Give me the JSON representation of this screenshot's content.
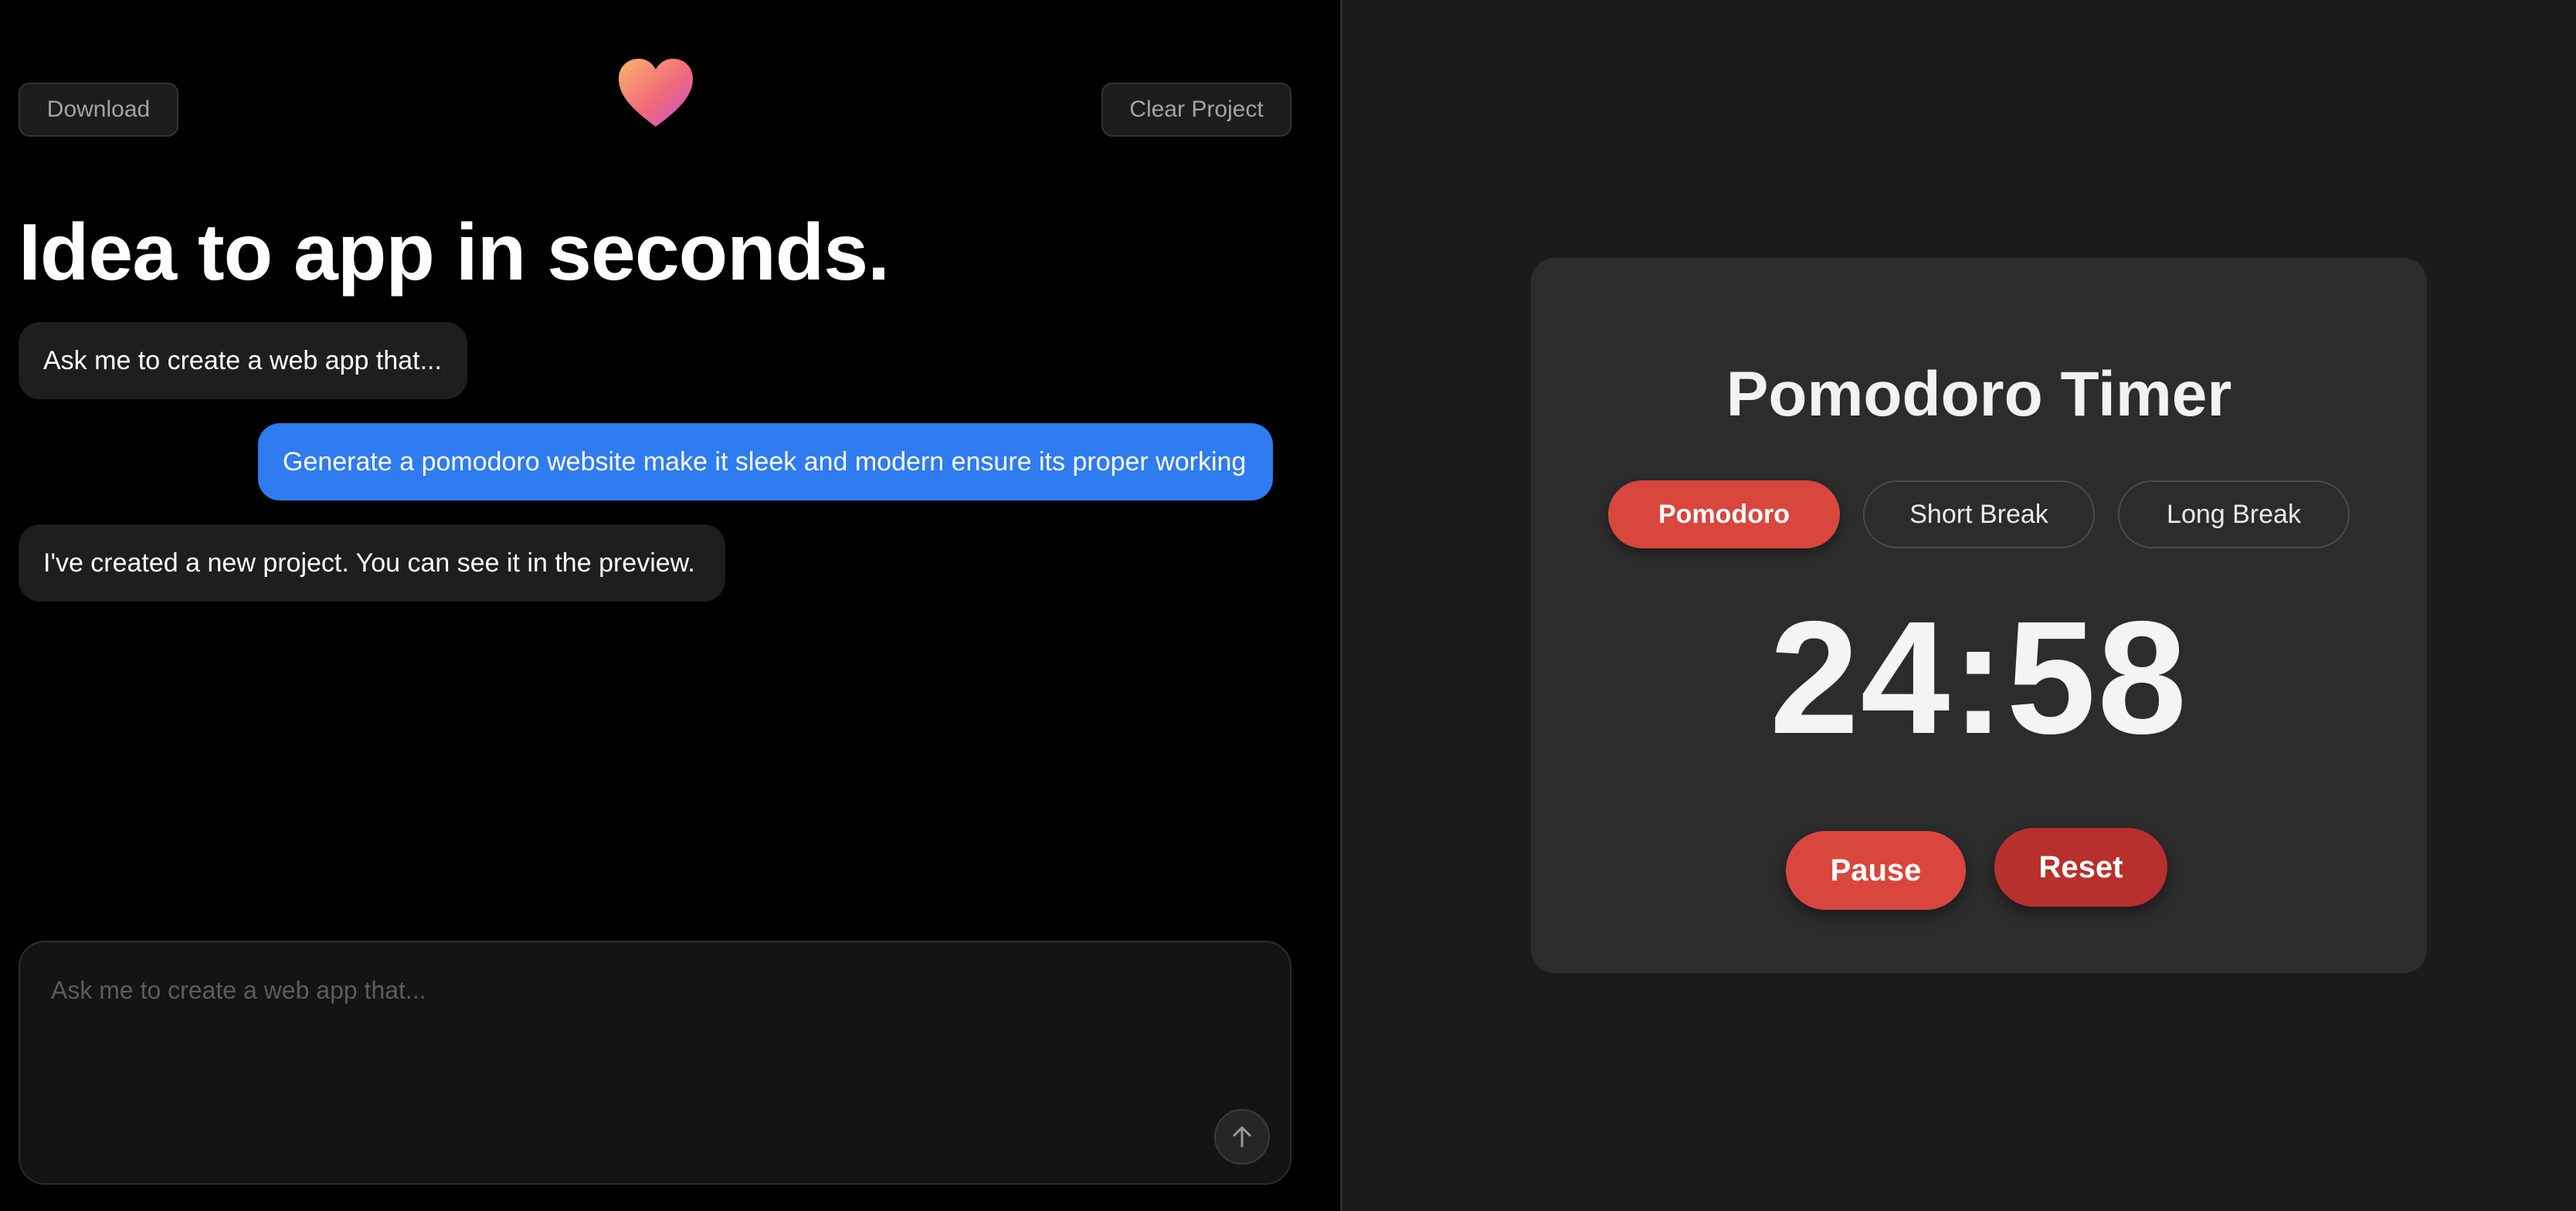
{
  "toolbar": {
    "download_label": "Download",
    "clear_label": "Clear Project"
  },
  "hero": {
    "headline": "Idea to app in seconds."
  },
  "chat": {
    "messages": [
      {
        "role": "assistant",
        "text": "Ask me to create a web app that..."
      },
      {
        "role": "user",
        "text": "Generate a pomodoro website make it sleek and modern ensure its proper working"
      },
      {
        "role": "assistant",
        "text": "I've created a new project. You can see it in the preview."
      }
    ]
  },
  "composer": {
    "placeholder": "Ask me to create a web app that...",
    "value": ""
  },
  "preview": {
    "title": "Pomodoro Timer",
    "modes": [
      {
        "label": "Pomodoro",
        "active": true
      },
      {
        "label": "Short Break",
        "active": false
      },
      {
        "label": "Long Break",
        "active": false
      }
    ],
    "time": "24:58",
    "pause_label": "Pause",
    "reset_label": "Reset"
  },
  "colors": {
    "user_bubble": "#2f7bf0",
    "accent_red": "#d9463e",
    "reset_red": "#b7302d"
  },
  "icons": {
    "logo": "heart-icon",
    "send": "arrow-up-icon"
  }
}
